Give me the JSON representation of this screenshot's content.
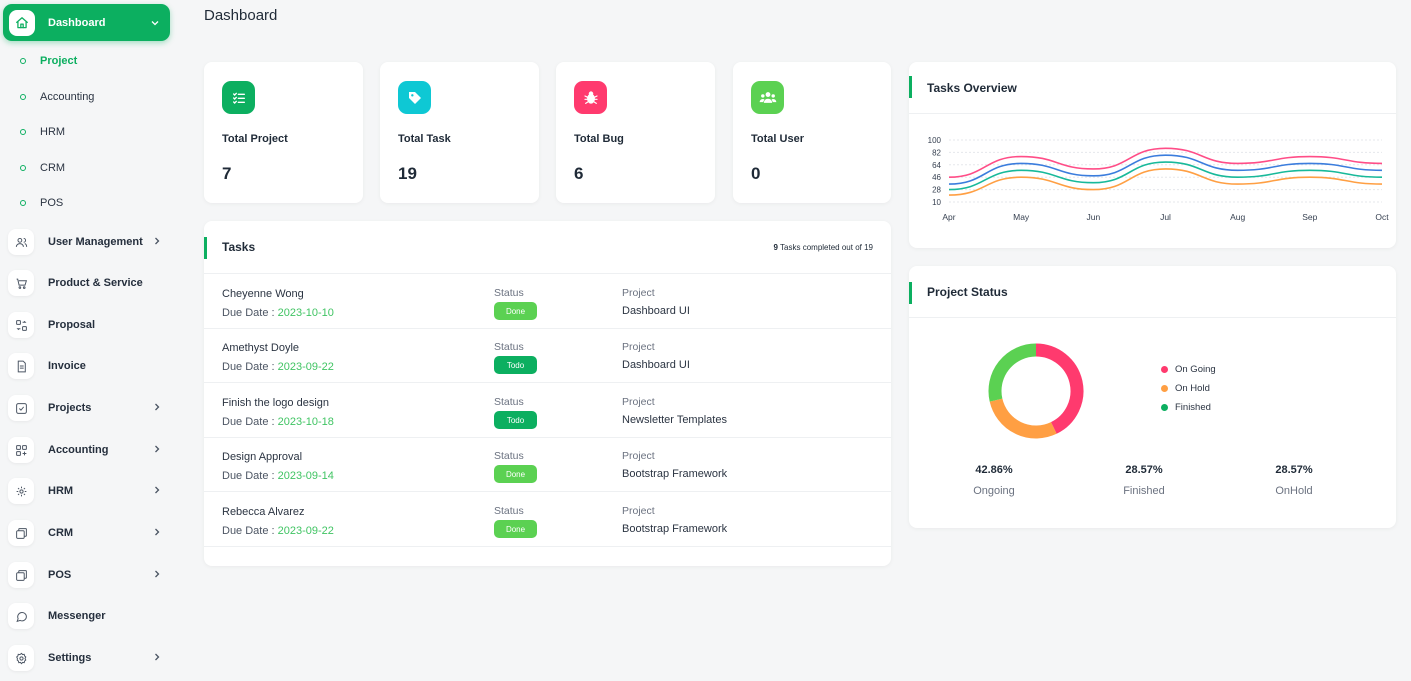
{
  "page_title": "Dashboard",
  "sidebar": {
    "active_item": {
      "label": "Dashboard",
      "icon": "home-icon"
    },
    "sub_items": [
      {
        "label": "Project",
        "active": true
      },
      {
        "label": "Accounting",
        "active": false
      },
      {
        "label": "HRM",
        "active": false
      },
      {
        "label": "CRM",
        "active": false
      },
      {
        "label": "POS",
        "active": false
      }
    ],
    "items": [
      {
        "label": "User Management",
        "icon": "users-icon",
        "has_submenu": true
      },
      {
        "label": "Product & Service",
        "icon": "cart-icon",
        "has_submenu": false
      },
      {
        "label": "Proposal",
        "icon": "proposal-icon",
        "has_submenu": false
      },
      {
        "label": "Invoice",
        "icon": "invoice-icon",
        "has_submenu": false
      },
      {
        "label": "Projects",
        "icon": "checkbox-icon",
        "has_submenu": true
      },
      {
        "label": "Accounting",
        "icon": "grid-icon",
        "has_submenu": true
      },
      {
        "label": "HRM",
        "icon": "hrm-icon",
        "has_submenu": true
      },
      {
        "label": "CRM",
        "icon": "layers-icon",
        "has_submenu": true
      },
      {
        "label": "POS",
        "icon": "layers-icon",
        "has_submenu": true
      },
      {
        "label": "Messenger",
        "icon": "chat-icon",
        "has_submenu": false
      },
      {
        "label": "Settings",
        "icon": "gear-icon",
        "has_submenu": true
      }
    ]
  },
  "stats": [
    {
      "title": "Total Project",
      "value": "7",
      "color": "#0caf60",
      "icon": "list-check-icon"
    },
    {
      "title": "Total Task",
      "value": "19",
      "color": "#0ec8d4",
      "icon": "tag-icon"
    },
    {
      "title": "Total Bug",
      "value": "6",
      "color": "#ff3a6e",
      "icon": "bug-icon"
    },
    {
      "title": "Total User",
      "value": "0",
      "color": "#5bd152",
      "icon": "users-icon"
    }
  ],
  "tasks": {
    "title": "Tasks",
    "completed_count": "9",
    "completed_text": " Tasks completed out of 19",
    "status_label": "Status",
    "project_label": "Project",
    "due_label": "Due Date : ",
    "rows": [
      {
        "name": "Cheyenne Wong",
        "due": "2023-10-10",
        "status": "Done",
        "status_color": "#5bd152",
        "project": "Dashboard UI"
      },
      {
        "name": "Amethyst Doyle",
        "due": "2023-09-22",
        "status": "Todo",
        "status_color": "#0caf60",
        "project": "Dashboard UI"
      },
      {
        "name": "Finish the logo design",
        "due": "2023-10-18",
        "status": "Todo",
        "status_color": "#0caf60",
        "project": "Newsletter Templates"
      },
      {
        "name": "Design Approval",
        "due": "2023-09-14",
        "status": "Done",
        "status_color": "#5bd152",
        "project": "Bootstrap Framework"
      },
      {
        "name": "Rebecca Alvarez",
        "due": "2023-09-22",
        "status": "Done",
        "status_color": "#5bd152",
        "project": "Bootstrap Framework"
      }
    ]
  },
  "overview": {
    "title": "Tasks Overview",
    "chart_data": {
      "type": "line",
      "x": [
        "Apr",
        "May",
        "Jun",
        "Jul",
        "Aug",
        "Sep",
        "Oct"
      ],
      "y_ticks": [
        100,
        82,
        64,
        46,
        28,
        10
      ],
      "ylim": [
        10,
        100
      ],
      "grid": true,
      "series": [
        {
          "color": "#ff4d87",
          "values": [
            46,
            76,
            58,
            88,
            66,
            76,
            66
          ]
        },
        {
          "color": "#3b7ddd",
          "values": [
            36,
            66,
            48,
            78,
            56,
            66,
            56
          ]
        },
        {
          "color": "#18b99a",
          "values": [
            28,
            56,
            38,
            68,
            46,
            56,
            46
          ]
        },
        {
          "color": "#ff9f43",
          "values": [
            20,
            46,
            28,
            58,
            36,
            46,
            36
          ]
        }
      ]
    }
  },
  "project_status": {
    "title": "Project Status",
    "chart_data": {
      "type": "pie",
      "categories": [
        "On Going",
        "On Hold",
        "Finished"
      ],
      "values": [
        42.86,
        28.57,
        28.57
      ],
      "colors": [
        "#ff3a6e",
        "#ff9f43",
        "#5bd152"
      ]
    },
    "legend": [
      {
        "label": "On Going",
        "color": "#ff3a6e"
      },
      {
        "label": "On Hold",
        "color": "#ff9f43"
      },
      {
        "label": "Finished",
        "color": "#0caf60"
      }
    ],
    "percentages": [
      {
        "value": "42.86%",
        "label": "Ongoing"
      },
      {
        "value": "28.57%",
        "label": "Finished"
      },
      {
        "value": "28.57%",
        "label": "OnHold"
      }
    ]
  }
}
